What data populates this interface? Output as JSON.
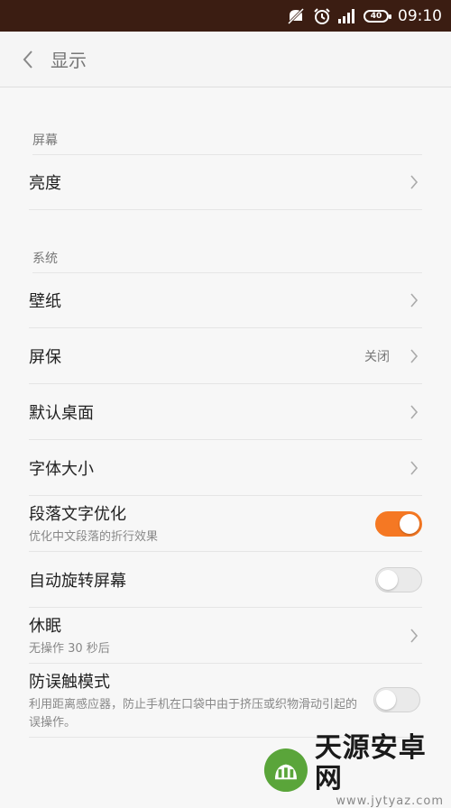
{
  "status_bar": {
    "time": "09:10",
    "battery": "40",
    "icons": [
      "notification-muted-icon",
      "alarm-icon",
      "signal-icon",
      "battery-icon"
    ]
  },
  "header": {
    "title": "显示"
  },
  "sections": {
    "screen": {
      "title": "屏幕",
      "items": [
        {
          "label": "亮度"
        }
      ]
    },
    "system": {
      "title": "系统",
      "wallpaper": {
        "label": "壁纸"
      },
      "screensaver": {
        "label": "屏保",
        "value": "关闭"
      },
      "launcher": {
        "label": "默认桌面"
      },
      "font_size": {
        "label": "字体大小"
      },
      "paragraph": {
        "label": "段落文字优化",
        "sub": "优化中文段落的折行效果",
        "on": true
      },
      "autorotate": {
        "label": "自动旋转屏幕",
        "on": false
      },
      "sleep": {
        "label": "休眠",
        "sub": "无操作 30 秒后"
      },
      "pocket": {
        "label": "防误触模式",
        "sub": "利用距离感应器，防止手机在口袋中由于挤压或织物滑动引起的误操作。",
        "on": false
      }
    }
  },
  "colors": {
    "accent": "#f57823",
    "statusbar": "#3b1d12"
  },
  "watermark": {
    "name": "天源安卓网",
    "url": "www.jytyaz.com"
  }
}
